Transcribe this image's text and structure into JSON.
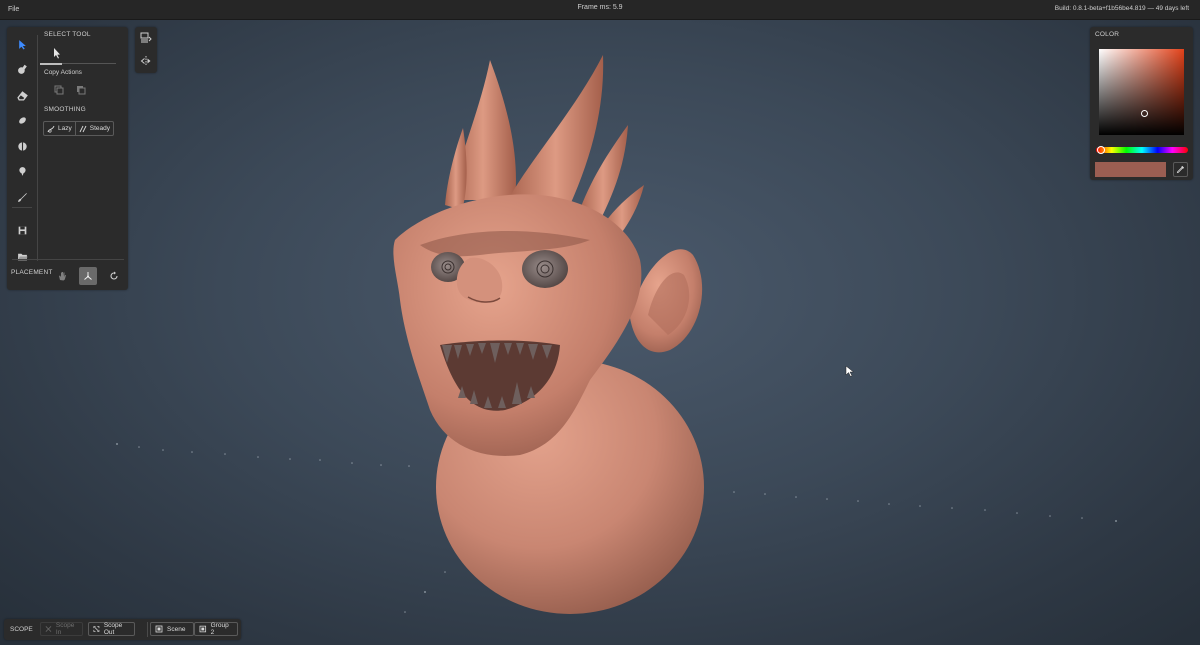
{
  "topbar": {
    "file_menu": "File",
    "frame_ms": "Frame ms: 5.9",
    "build": "Build: 0.8.1-beta+f1b56be4.819 — 49 days left"
  },
  "tools": {
    "select_title": "SELECT TOOL",
    "copy_actions": "Copy Actions",
    "smoothing_title": "SMOOTHING",
    "smoothing_lazy": "Lazy",
    "smoothing_steady": "Steady",
    "placement_title": "PLACEMENT",
    "items": [
      "select-icon",
      "brush-icon",
      "eraser-icon",
      "smooth-icon",
      "sphere-icon",
      "paint-icon",
      "pen-icon"
    ]
  },
  "color": {
    "title": "COLOR",
    "base_hue": "#e2421a",
    "current_color": "#9b5e52"
  },
  "scope": {
    "label": "SCOPE",
    "scope_in": "Scope In",
    "scope_out": "Scope Out",
    "scene": "Scene",
    "group": "Group 2"
  },
  "model": {
    "skin_color": "#c98672",
    "teeth_color": "#6d5e5c"
  }
}
